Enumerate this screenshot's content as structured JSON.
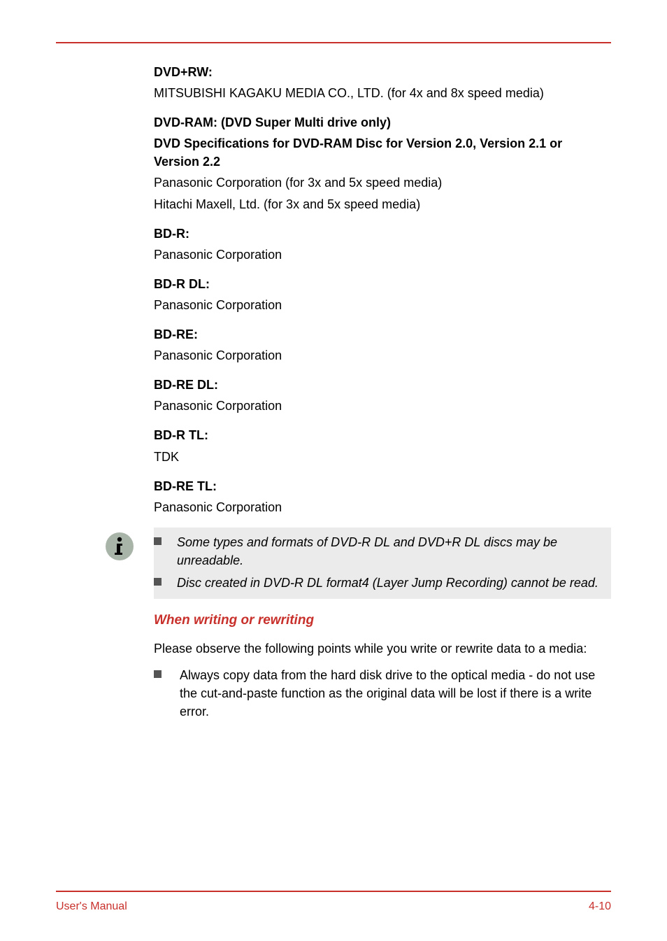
{
  "media": {
    "dvdPlusRw": {
      "label": "DVD+RW:",
      "line1": "MITSUBISHI KAGAKU MEDIA CO., LTD. (for 4x and 8x speed media)"
    },
    "dvdRam": {
      "label": "DVD-RAM: (DVD Super Multi drive only)",
      "spec": "DVD Specifications for DVD-RAM Disc for Version 2.0, Version 2.1 or Version 2.2",
      "line1": "Panasonic Corporation (for 3x and 5x speed media)",
      "line2": "Hitachi Maxell, Ltd. (for 3x and 5x speed media)"
    },
    "bdR": {
      "label": "BD-R:",
      "line1": "Panasonic Corporation"
    },
    "bdRDl": {
      "label": "BD-R DL:",
      "line1": "Panasonic Corporation"
    },
    "bdRe": {
      "label": "BD-RE:",
      "line1": "Panasonic Corporation"
    },
    "bdReDl": {
      "label": "BD-RE DL:",
      "line1": "Panasonic Corporation"
    },
    "bdRTl": {
      "label": "BD-R TL:",
      "line1": "TDK"
    },
    "bdReTl": {
      "label": "BD-RE TL:",
      "line1": "Panasonic Corporation"
    }
  },
  "notes": {
    "item1": "Some types and formats of DVD-R DL and DVD+R DL discs may be unreadable.",
    "item2": "Disc created in DVD-R DL format4 (Layer Jump Recording) cannot be read."
  },
  "section": {
    "heading": "When writing or rewriting",
    "intro": "Please observe the following points while you write or rewrite data to a media:",
    "bullet1": "Always copy data from the hard disk drive to the optical media - do not use the cut-and-paste function as the original data will be lost if there is a write error."
  },
  "footer": {
    "left": "User's Manual",
    "right": "4-10"
  }
}
